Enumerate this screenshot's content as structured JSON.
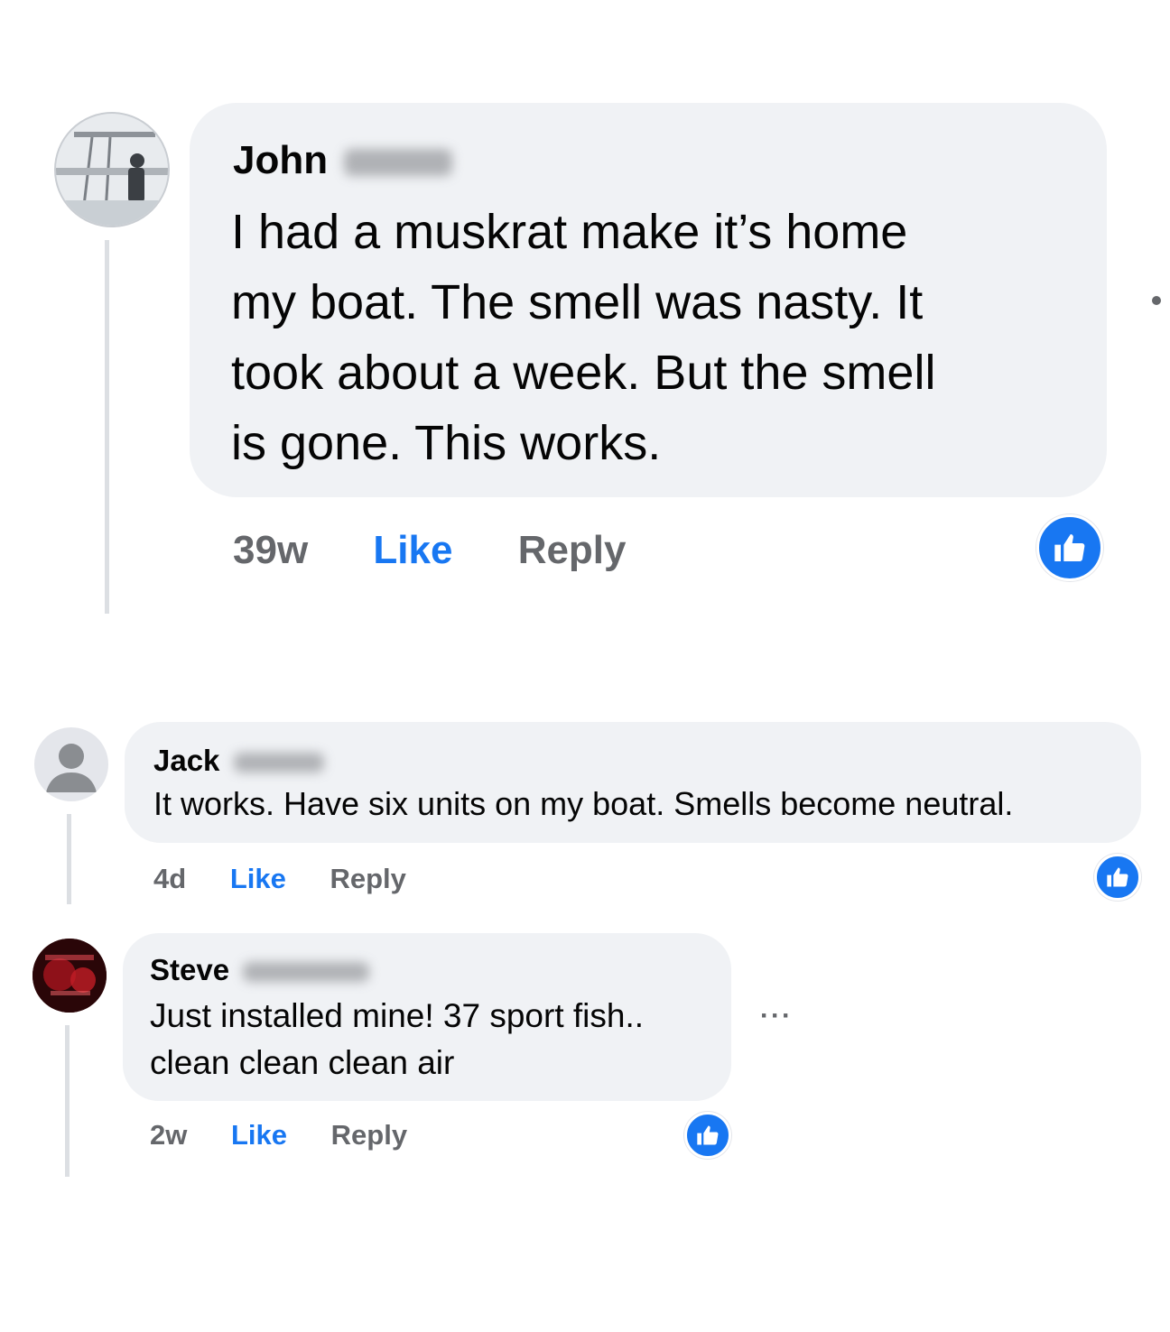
{
  "comments": [
    {
      "author_first": "John",
      "text_lines": [
        "I had a muskrat make it’s home",
        "my boat. The smell was nasty. It",
        "took about a week. But the smell",
        "is gone. This works."
      ],
      "time": "39w",
      "like_label": "Like",
      "reply_label": "Reply",
      "reaction_icon": "like-icon"
    },
    {
      "author_first": "Jack",
      "text_lines": [
        "It works. Have six units on my boat. Smells become neutral."
      ],
      "time": "4d",
      "like_label": "Like",
      "reply_label": "Reply",
      "reaction_icon": "like-icon"
    },
    {
      "author_first": "Steve",
      "text_lines": [
        "Just installed mine! 37 sport fish..",
        "clean clean clean air"
      ],
      "time": "2w",
      "like_label": "Like",
      "reply_label": "Reply",
      "reaction_icon": "like-icon",
      "more_label": "···"
    }
  ],
  "colors": {
    "bubble": "#f0f2f5",
    "link_blue": "#1877f2",
    "meta_gray": "#65676b",
    "thread_line": "#dcdfe3"
  }
}
